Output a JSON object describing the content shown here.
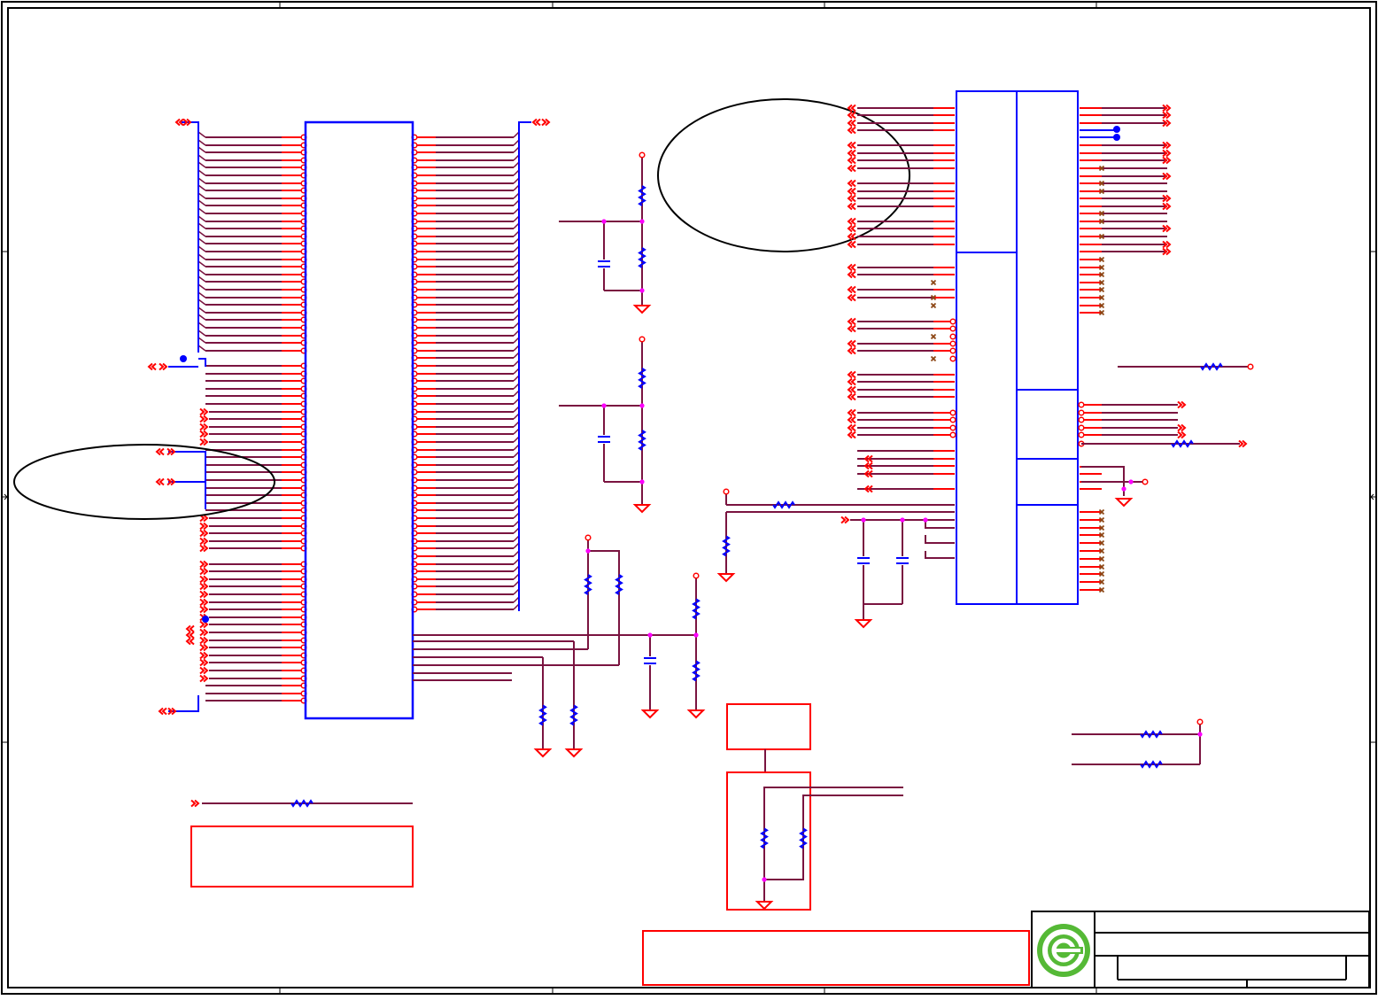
{
  "schematic": {
    "colors": {
      "wire": "#7a1440",
      "pin": "#ff0000",
      "component_body": "#0000ff",
      "ellipse": "#000000",
      "junction": "#ff00ff",
      "frame": "#000000",
      "logo_green": "#55b936"
    },
    "icons": [
      "connector-arrow-icon",
      "ground-icon",
      "resistor-icon",
      "capacitor-icon",
      "no-connect-icon",
      "logo-icon"
    ]
  }
}
